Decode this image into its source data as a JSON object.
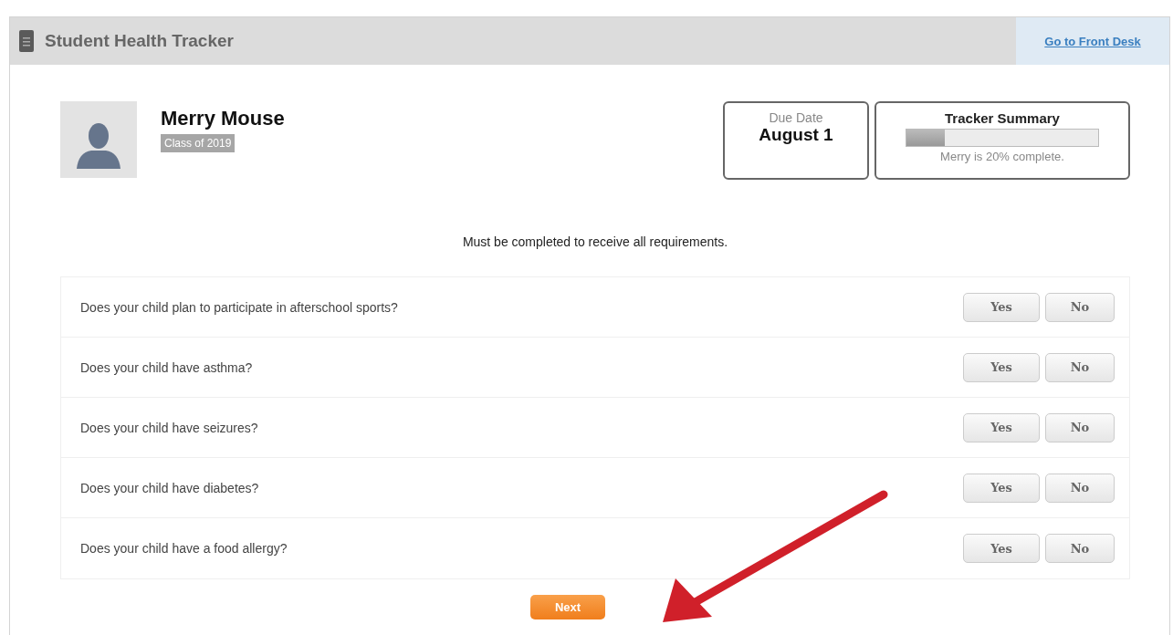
{
  "header": {
    "title": "Student Health Tracker",
    "link": "Go to Front Desk"
  },
  "student": {
    "name": "Merry Mouse",
    "class": "Class of 2019"
  },
  "due_date": {
    "label": "Due Date",
    "value": "August 1"
  },
  "tracker_summary": {
    "title": "Tracker Summary",
    "level": 0.2,
    "caption": "Merry is 20% complete."
  },
  "instruction": "Must be completed to receive all requirements.",
  "questions": [
    {
      "text": "Does your child plan to participate in afterschool sports?",
      "buttons": [
        "Yes",
        "No"
      ]
    },
    {
      "text": "Does your child have asthma?",
      "buttons": [
        "Yes",
        "No"
      ]
    },
    {
      "text": "Does your child have seizures?",
      "buttons": [
        "Yes",
        "No"
      ]
    },
    {
      "text": "Does your child have diabetes?",
      "buttons": [
        "Yes",
        "No"
      ]
    },
    {
      "text": "Does your child have a food allergy?",
      "buttons": [
        "Yes",
        "No"
      ]
    }
  ],
  "next_button": "Next"
}
